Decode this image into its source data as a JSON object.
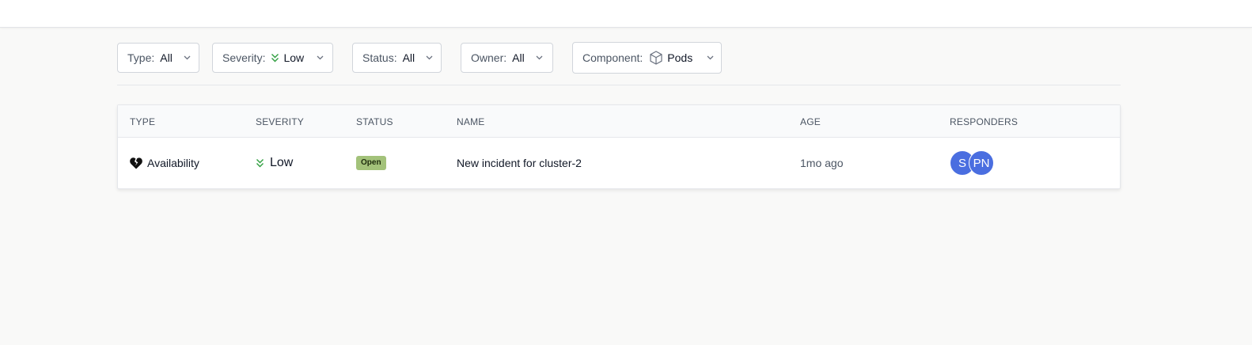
{
  "filters": {
    "type": {
      "label": "Type:",
      "value": "All"
    },
    "severity": {
      "label": "Severity:",
      "value": "Low",
      "icon": "chevrons-down-icon"
    },
    "status": {
      "label": "Status:",
      "value": "All"
    },
    "owner": {
      "label": "Owner:",
      "value": "All"
    },
    "component": {
      "label": "Component:",
      "value": "Pods",
      "icon": "cube-icon"
    }
  },
  "table": {
    "columns": [
      "TYPE",
      "SEVERITY",
      "STATUS",
      "NAME",
      "AGE",
      "RESPONDERS"
    ],
    "rows": [
      {
        "type": "Availability",
        "type_icon": "broken-heart-icon",
        "severity": "Low",
        "severity_icon": "chevrons-down-icon",
        "status": "Open",
        "name": "New incident for cluster-2",
        "age": "1mo ago",
        "responders": [
          "S",
          "PN"
        ]
      }
    ]
  },
  "colors": {
    "accent_avatar": "#4a6ee0",
    "status_open": "#a3c27a",
    "severity_low": "#2e9e3e"
  }
}
